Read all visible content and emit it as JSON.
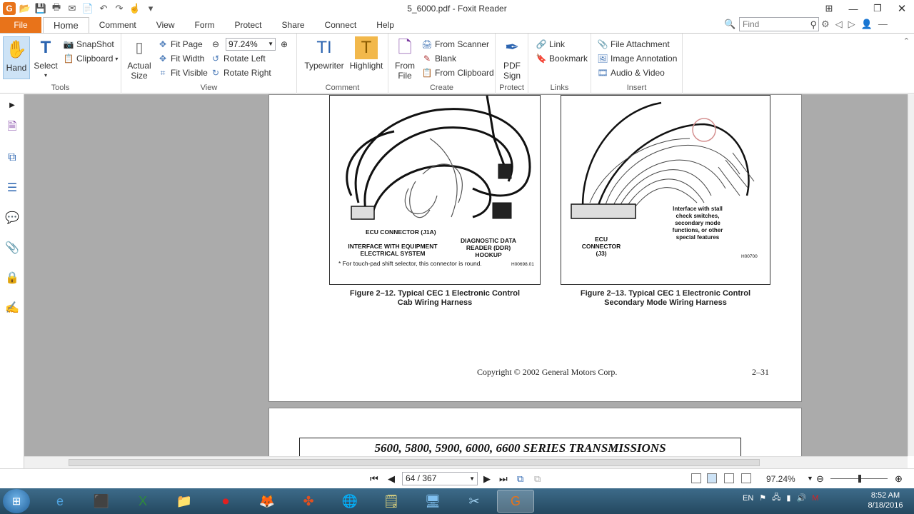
{
  "window": {
    "title": "5_6000.pdf - Foxit Reader"
  },
  "tabs": {
    "file": "File",
    "items": [
      "Home",
      "Comment",
      "View",
      "Form",
      "Protect",
      "Share",
      "Connect",
      "Help"
    ]
  },
  "search": {
    "placeholder": "Find"
  },
  "ribbon": {
    "tools": {
      "label": "Tools",
      "hand": "Hand",
      "select": "Select",
      "snapshot": "SnapShot",
      "clipboard": "Clipboard"
    },
    "view": {
      "label": "View",
      "actual_size_1": "Actual",
      "actual_size_2": "Size",
      "fit_page": "Fit Page",
      "fit_width": "Fit Width",
      "fit_visible": "Fit Visible",
      "zoom": "97.24%",
      "rotate_left": "Rotate Left",
      "rotate_right": "Rotate Right"
    },
    "comment": {
      "label": "Comment",
      "typewriter": "Typewriter",
      "highlight": "Highlight"
    },
    "create": {
      "label": "Create",
      "from_file_1": "From",
      "from_file_2": "File",
      "from_scanner": "From Scanner",
      "blank": "Blank",
      "from_clipboard": "From Clipboard"
    },
    "protect": {
      "label": "Protect",
      "pdf_sign_1": "PDF",
      "pdf_sign_2": "Sign"
    },
    "links": {
      "label": "Links",
      "link": "Link",
      "bookmark": "Bookmark"
    },
    "insert": {
      "label": "Insert",
      "file_attachment": "File Attachment",
      "image_annotation": "Image Annotation",
      "audio_video": "Audio & Video"
    }
  },
  "document": {
    "fig12": {
      "caption_1": "Figure 2–12.  Typical CEC 1 Electronic Control",
      "caption_2": "Cab Wiring Harness",
      "lbl_ecu": "ECU CONNECTOR (J1A)",
      "lbl_iface_1": "INTERFACE WITH EQUIPMENT",
      "lbl_iface_2": "ELECTRICAL SYSTEM",
      "lbl_ddr_1": "DIAGNOSTIC DATA",
      "lbl_ddr_2": "READER (DDR)",
      "lbl_ddr_3": "HOOKUP",
      "note": "* For touch-pad shift selector, this connector is round.",
      "code": "H00698.01"
    },
    "fig13": {
      "caption_1": "Figure 2–13.  Typical CEC 1 Electronic Control",
      "caption_2": "Secondary Mode Wiring Harness",
      "lbl_iface_1": "Interface with stall",
      "lbl_iface_2": "check switches,",
      "lbl_iface_3": "secondary mode",
      "lbl_iface_4": "functions, or other",
      "lbl_iface_5": "special features",
      "lbl_ecu_1": "ECU",
      "lbl_ecu_2": "CONNECTOR",
      "lbl_ecu_3": "(J3)",
      "code": "H00700"
    },
    "copyright": "Copyright © 2002 General Motors Corp.",
    "page_number": "2–31",
    "next_page_header": "5600, 5800, 5900, 6000, 6600 SERIES TRANSMISSIONS"
  },
  "status": {
    "page_indicator": "64 / 367",
    "zoom": "97.24%"
  },
  "taskbar": {
    "lang": "EN",
    "time": "8:52 AM",
    "date": "8/18/2016"
  }
}
